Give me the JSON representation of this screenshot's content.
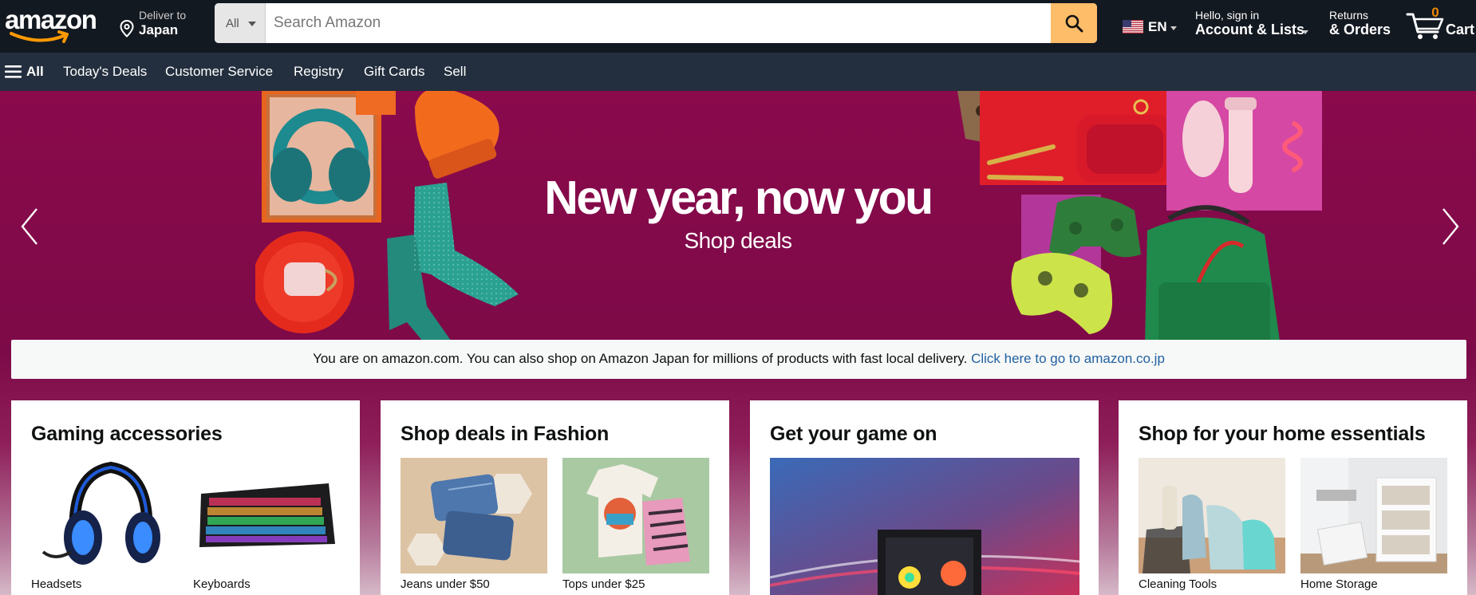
{
  "header": {
    "logo_text": "amazon",
    "deliver": {
      "line1": "Deliver to",
      "line2": "Japan"
    },
    "search": {
      "category": "All",
      "placeholder": "Search Amazon"
    },
    "language": "EN",
    "account": {
      "line1": "Hello, sign in",
      "line2": "Account & Lists"
    },
    "returns": {
      "line1": "Returns",
      "line2": "& Orders"
    },
    "cart": {
      "count": "0",
      "label": "Cart"
    }
  },
  "nav": {
    "all_label": "All",
    "links": [
      "Today's Deals",
      "Customer Service",
      "Registry",
      "Gift Cards",
      "Sell"
    ]
  },
  "hero": {
    "headline": "New year, now you",
    "subline": "Shop deals"
  },
  "notice": {
    "text": "You are on amazon.com. You can also shop on Amazon Japan for millions of products with fast local delivery. ",
    "link": "Click here to go to amazon.co.jp"
  },
  "cards": [
    {
      "title": "Gaming accessories",
      "items": [
        {
          "label": "Headsets",
          "icon": "headset-image"
        },
        {
          "label": "Keyboards",
          "icon": "keyboard-image"
        }
      ]
    },
    {
      "title": "Shop deals in Fashion",
      "items": [
        {
          "label": "Jeans under $50",
          "icon": "jeans-image"
        },
        {
          "label": "Tops under $25",
          "icon": "tops-image"
        }
      ]
    },
    {
      "title": "Get your game on",
      "items": [
        {
          "label": "",
          "icon": "gaming-pc-image"
        }
      ]
    },
    {
      "title": "Shop for your home essentials",
      "items": [
        {
          "label": "Cleaning Tools",
          "icon": "cleaning-tools-image"
        },
        {
          "label": "Home Storage",
          "icon": "home-storage-image"
        }
      ]
    }
  ],
  "colors": {
    "header_bg": "#131921",
    "nav_bg": "#232f3e",
    "search_button": "#febd69",
    "cart_count": "#f08804",
    "hero_bg": "#8a0a4c",
    "link": "#2162a1"
  }
}
